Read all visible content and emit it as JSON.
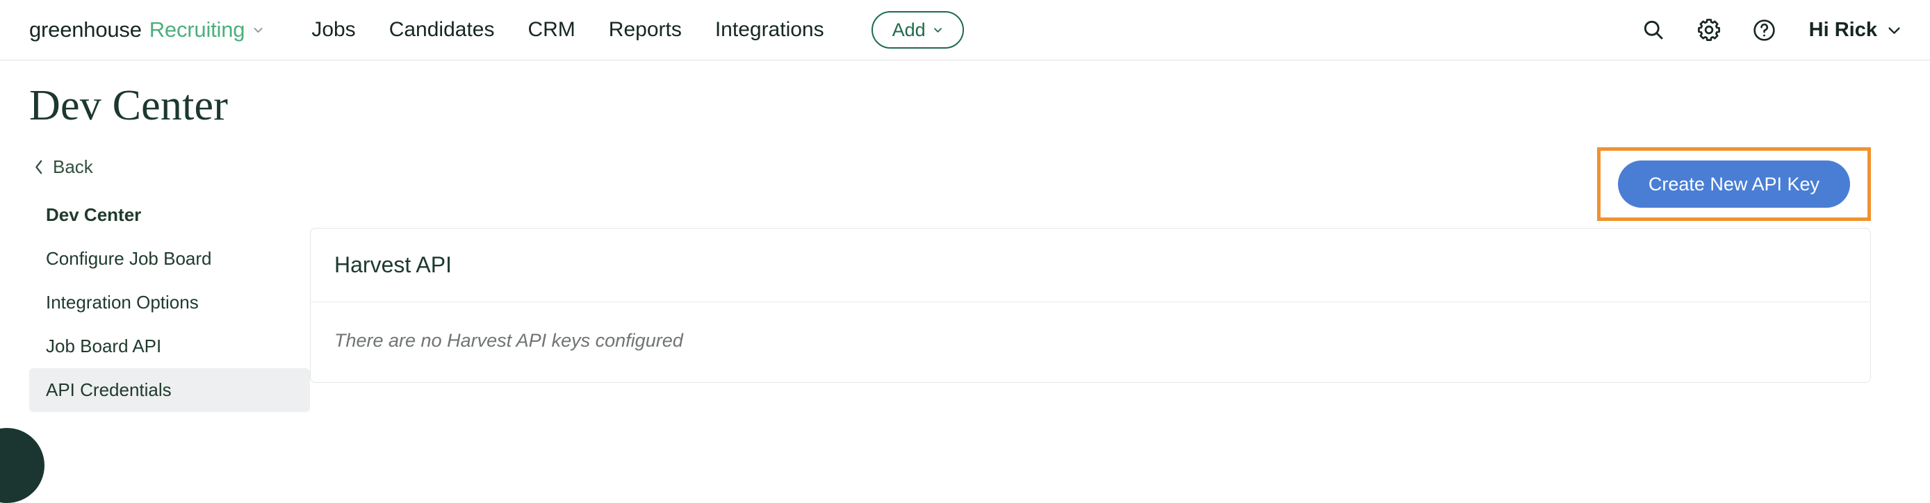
{
  "topnav": {
    "brand": {
      "word1": "greenhouse",
      "word2": "Recruiting",
      "caret_icon": "chevron-down-icon"
    },
    "links": [
      {
        "label": "Jobs"
      },
      {
        "label": "Candidates"
      },
      {
        "label": "CRM"
      },
      {
        "label": "Reports"
      },
      {
        "label": "Integrations"
      }
    ],
    "add_button": {
      "label": "Add",
      "caret_icon": "chevron-down-icon"
    },
    "right": {
      "search_icon": "search-icon",
      "settings_icon": "gear-icon",
      "help_icon": "question-circle-icon",
      "user_label": "Hi Rick",
      "user_caret_icon": "chevron-down-icon"
    }
  },
  "page": {
    "title": "Dev Center"
  },
  "sidebar": {
    "back": {
      "label": "Back",
      "icon": "chevron-left-icon"
    },
    "items": [
      {
        "label": "Dev Center",
        "bold": true,
        "active": false
      },
      {
        "label": "Configure Job Board",
        "bold": false,
        "active": false
      },
      {
        "label": "Integration Options",
        "bold": false,
        "active": false
      },
      {
        "label": "Job Board API",
        "bold": false,
        "active": false
      },
      {
        "label": "API Credentials",
        "bold": false,
        "active": true
      }
    ]
  },
  "main": {
    "create_key_button": {
      "label": "Create New API Key",
      "background": "#4a7ed4",
      "text_color": "#ffffff"
    },
    "highlight": {
      "color": "#f0922f"
    },
    "panel": {
      "title": "Harvest API",
      "empty_message": "There are no Harvest API keys configured"
    }
  },
  "widgets": {
    "chat_bubble": "chat-widget-button"
  },
  "colors": {
    "brand_green": "#4caf7d",
    "dark_green": "#16271f",
    "accent_blue": "#4a7ed4",
    "highlight_orange": "#f0922f",
    "active_item_bg": "#eeeff0"
  }
}
